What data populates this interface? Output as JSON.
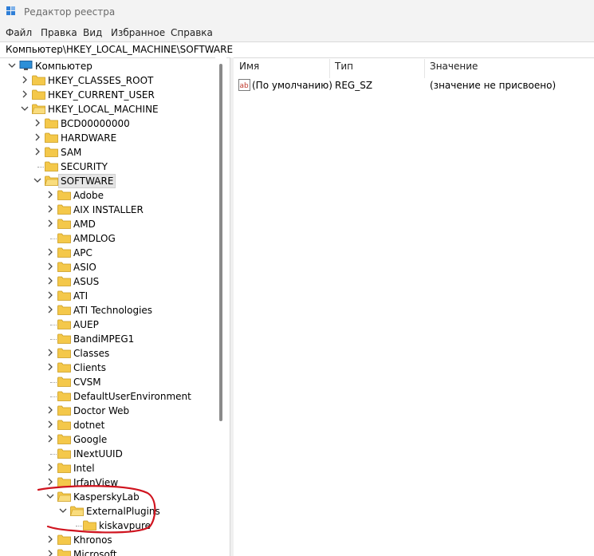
{
  "window": {
    "title": "Редактор реестра"
  },
  "menu": [
    "Файл",
    "Правка",
    "Вид",
    "Избранное",
    "Справка"
  ],
  "address": "Компьютер\\HKEY_LOCAL_MACHINE\\SOFTWARE",
  "tree": [
    {
      "label": "Компьютер",
      "level": 0,
      "expanded": true,
      "icon": "computer-icon"
    },
    {
      "label": "HKEY_CLASSES_ROOT",
      "level": 1,
      "expanded": false
    },
    {
      "label": "HKEY_CURRENT_USER",
      "level": 1,
      "expanded": false
    },
    {
      "label": "HKEY_LOCAL_MACHINE",
      "level": 1,
      "expanded": true
    },
    {
      "label": "BCD00000000",
      "level": 2,
      "expanded": false
    },
    {
      "label": "HARDWARE",
      "level": 2,
      "expanded": false
    },
    {
      "label": "SAM",
      "level": 2,
      "expanded": false
    },
    {
      "label": "SECURITY",
      "level": 2,
      "leaf": true
    },
    {
      "label": "SOFTWARE",
      "level": 2,
      "expanded": true,
      "selected": true
    },
    {
      "label": "Adobe",
      "level": 3,
      "expanded": false
    },
    {
      "label": "AIX INSTALLER",
      "level": 3,
      "expanded": false
    },
    {
      "label": "AMD",
      "level": 3,
      "expanded": false
    },
    {
      "label": "AMDLOG",
      "level": 3,
      "leaf": true
    },
    {
      "label": "APC",
      "level": 3,
      "expanded": false
    },
    {
      "label": "ASIO",
      "level": 3,
      "expanded": false
    },
    {
      "label": "ASUS",
      "level": 3,
      "expanded": false
    },
    {
      "label": "ATI",
      "level": 3,
      "expanded": false
    },
    {
      "label": "ATI Technologies",
      "level": 3,
      "expanded": false
    },
    {
      "label": "AUEP",
      "level": 3,
      "leaf": true
    },
    {
      "label": "BandiMPEG1",
      "level": 3,
      "leaf": true
    },
    {
      "label": "Classes",
      "level": 3,
      "expanded": false
    },
    {
      "label": "Clients",
      "level": 3,
      "expanded": false
    },
    {
      "label": "CVSM",
      "level": 3,
      "leaf": true
    },
    {
      "label": "DefaultUserEnvironment",
      "level": 3,
      "leaf": true
    },
    {
      "label": "Doctor Web",
      "level": 3,
      "expanded": false
    },
    {
      "label": "dotnet",
      "level": 3,
      "expanded": false
    },
    {
      "label": "Google",
      "level": 3,
      "expanded": false
    },
    {
      "label": "INextUUID",
      "level": 3,
      "leaf": true
    },
    {
      "label": "Intel",
      "level": 3,
      "expanded": false
    },
    {
      "label": "IrfanView",
      "level": 3,
      "expanded": false
    },
    {
      "label": "KasperskyLab",
      "level": 3,
      "expanded": true
    },
    {
      "label": "ExternalPlugins",
      "level": 4,
      "expanded": true
    },
    {
      "label": "kiskavpure",
      "level": 5,
      "leaf": true
    },
    {
      "label": "Khronos",
      "level": 3,
      "expanded": false
    },
    {
      "label": "Microsoft",
      "level": 3,
      "expanded": false
    }
  ],
  "list": {
    "columns": [
      "Имя",
      "Тип",
      "Значение"
    ],
    "rows": [
      {
        "name": "(По умолчанию)",
        "type": "REG_SZ",
        "value": "(значение не присвоено)",
        "icon": "string-value-icon"
      }
    ]
  },
  "colors": {
    "folder": "#f4c84a",
    "annotation": "#d0141f",
    "chevron": "#444444"
  }
}
